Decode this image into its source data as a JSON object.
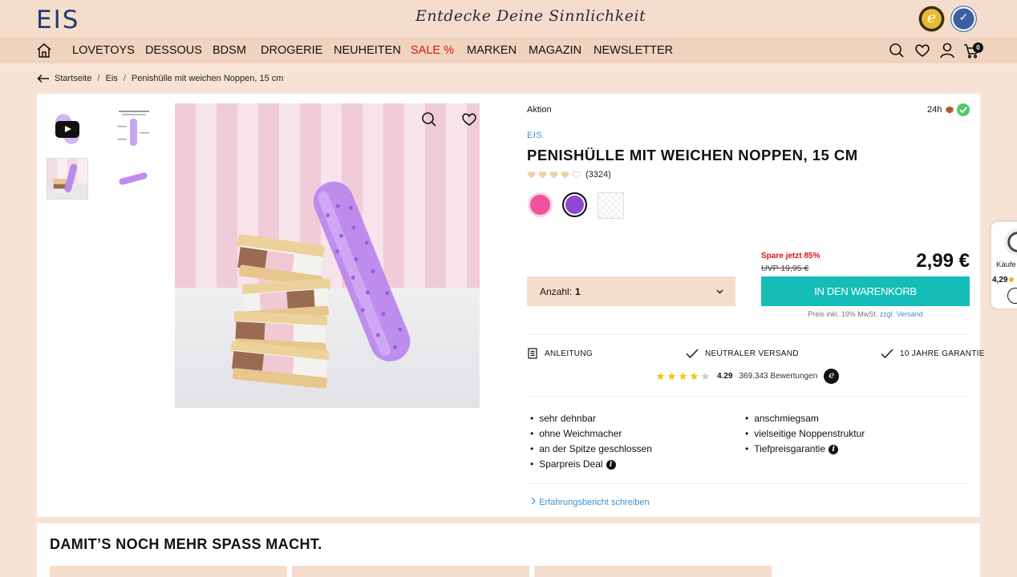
{
  "header": {
    "logo": "EIS",
    "tagline": "Entdecke Deine Sinnlichkeit",
    "seal_left": "e",
    "seal_right": "✓"
  },
  "nav": {
    "items": [
      "LOVETOYS",
      "DESSOUS",
      "BDSM",
      "DROGERIE",
      "NEUHEITEN",
      "SALE %",
      "MARKEN",
      "MAGAZIN",
      "NEWSLETTER"
    ],
    "cart_count": "0",
    "sale_color": "#e01010"
  },
  "breadcrumb": {
    "items": [
      "Startseite",
      "Eis",
      "Penishülle mit weichen Noppen, 15 cm"
    ],
    "separator": "/"
  },
  "product": {
    "badge": "Aktion",
    "delivery": "24h",
    "brand": "EIS",
    "title": "PENISHÜLLE MIT WEICHEN NOPPEN, 15 CM",
    "rating_hearts": 4,
    "review_count": "(3324)",
    "colors": [
      "#f2519e",
      "#9146d3",
      "transparent"
    ],
    "selected_color_index": 1,
    "save_text": "Spare jetzt 85%",
    "uvp": "UVP 19,95 €",
    "price": "2,99 €",
    "quantity_label": "Anzahl:",
    "quantity_value": "1",
    "cart_button": "IN DEN WARENKORB",
    "tax_note": "Preis inkl. 19% MwSt.",
    "shipping_link": "zzgl. Versand",
    "accent_color": "#16bdb8"
  },
  "features": {
    "manual": "ANLEITUNG",
    "neutral_shipping": "NEUTRALER VERSAND",
    "guarantee": "10 JAHRE GARANTIE"
  },
  "trusted": {
    "stars": 4.29,
    "score": "4.29",
    "count": "369.343 Bewertungen",
    "logo_letter": "e"
  },
  "bullets_left": [
    "sehr dehnbar",
    "ohne Weichmacher",
    "an der Spitze geschlossen",
    "Sparpreis Deal"
  ],
  "bullets_right": [
    "anschmiegsam",
    "vielseitige Noppenstruktur",
    "Tiefpreisgarantie"
  ],
  "review_link": "Erfahrungsbericht schreiben",
  "side_widget": {
    "label": "Käufe",
    "score": "4,29",
    "star": "★",
    "logo_letter": "e"
  },
  "bottom": {
    "title": "DAMIT’S NOCH MEHR SPASS MACHT."
  },
  "info_glyph": "i"
}
